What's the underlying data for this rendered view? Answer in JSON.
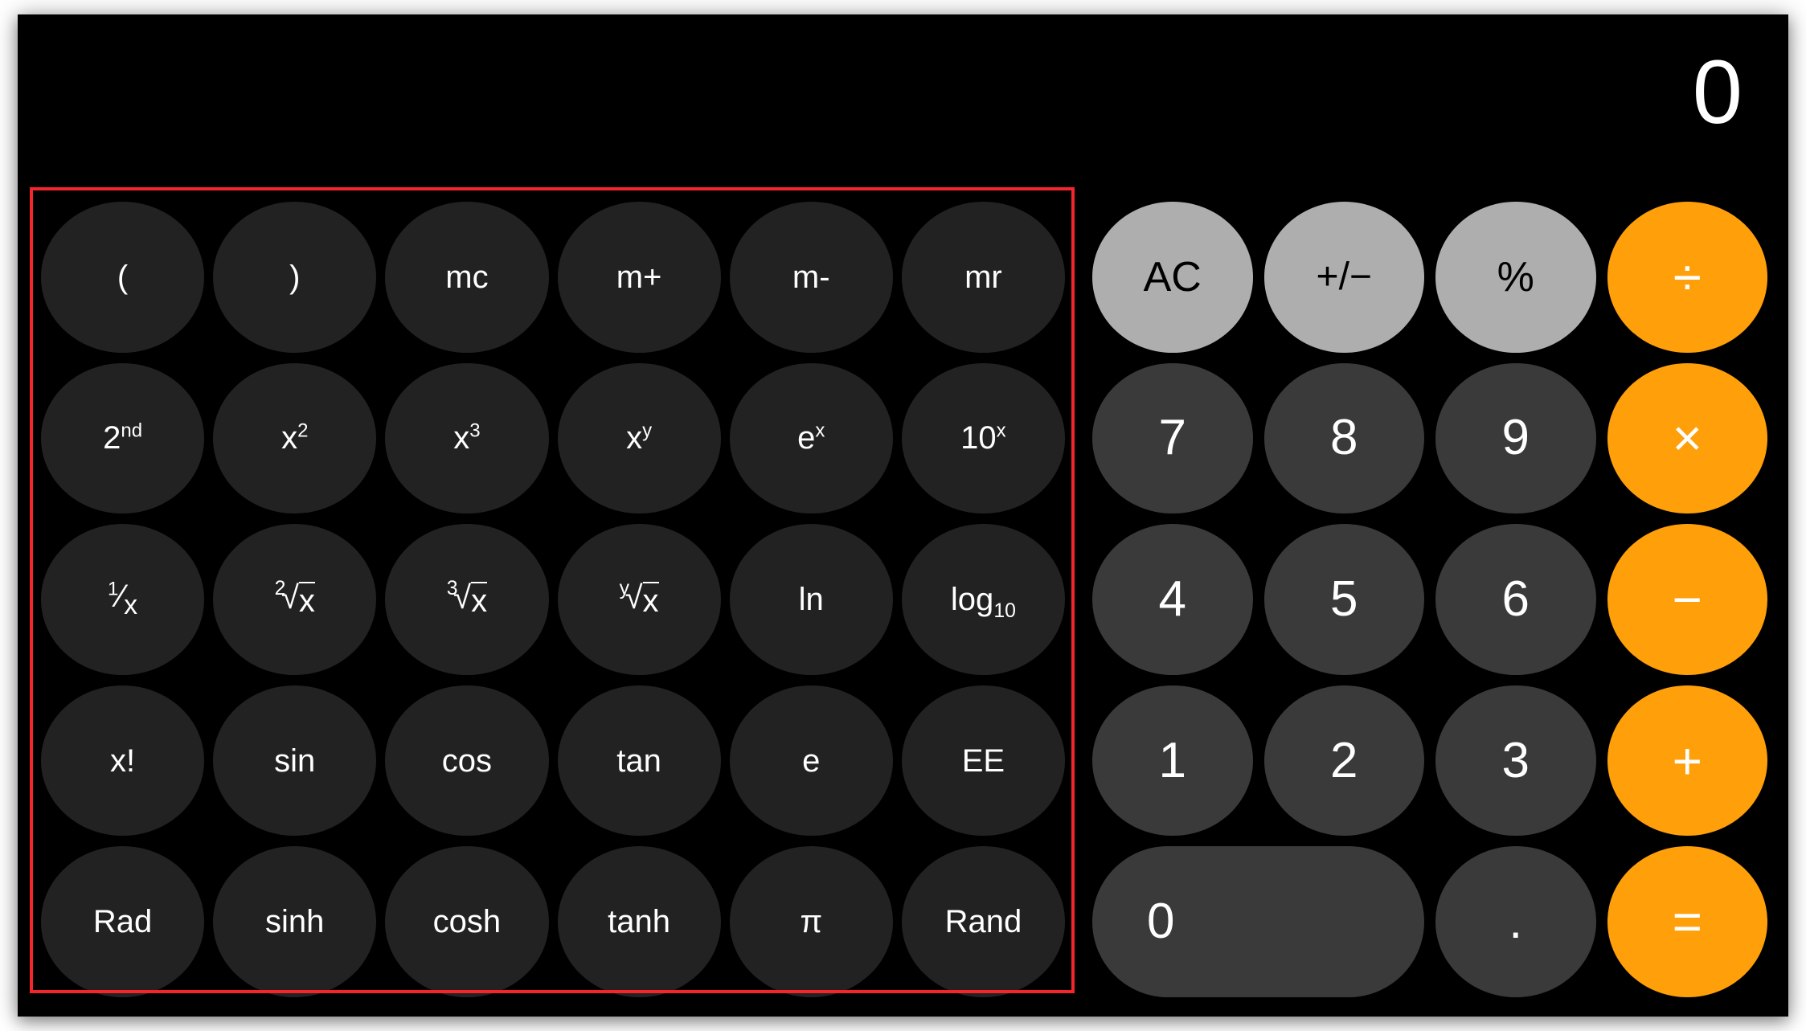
{
  "app": {
    "name": "Calculator",
    "mode": "scientific",
    "theme": "dark"
  },
  "display": {
    "value": "0",
    "alignment": "right"
  },
  "colors": {
    "background": "#000000",
    "scientific_key": "#222222",
    "number_key": "#3a3a3a",
    "function_key": "#aeaeae",
    "operator_key": "#ff9f0a",
    "text_light": "#ffffff",
    "text_dark": "#000000",
    "annotation_box": "#f5252d"
  },
  "annotation": {
    "shape": "rectangle",
    "target": "scientific-keypad",
    "color": "#f5252d"
  },
  "scientific_keypad": {
    "columns": 6,
    "rows": 5,
    "keys": [
      {
        "id": "open-paren",
        "label": "(",
        "name": "key-open-paren"
      },
      {
        "id": "close-paren",
        "label": ")",
        "name": "key-close-paren"
      },
      {
        "id": "mem-clear",
        "label": "mc",
        "name": "key-memory-clear"
      },
      {
        "id": "mem-add",
        "label": "m+",
        "name": "key-memory-add"
      },
      {
        "id": "mem-subtract",
        "label": "m-",
        "name": "key-memory-subtract"
      },
      {
        "id": "mem-recall",
        "label": "mr",
        "name": "key-memory-recall"
      },
      {
        "id": "second",
        "label": "2nd",
        "base": "2",
        "sup": "nd",
        "name": "key-second"
      },
      {
        "id": "x-squared",
        "label": "x2",
        "base": "x",
        "sup": "2",
        "name": "key-x-squared"
      },
      {
        "id": "x-cubed",
        "label": "x3",
        "base": "x",
        "sup": "3",
        "name": "key-x-cubed"
      },
      {
        "id": "x-power-y",
        "label": "xy",
        "base": "x",
        "sup": "y",
        "name": "key-x-power-y"
      },
      {
        "id": "e-power-x",
        "label": "ex",
        "base": "e",
        "sup": "x",
        "name": "key-e-power-x"
      },
      {
        "id": "ten-power-x",
        "label": "10x",
        "base": "10",
        "sup": "x",
        "name": "key-ten-power-x"
      },
      {
        "id": "reciprocal",
        "label": "1/x",
        "name": "key-reciprocal"
      },
      {
        "id": "square-root",
        "label": "2√x",
        "index": "2",
        "radicand": "x",
        "name": "key-square-root"
      },
      {
        "id": "cube-root",
        "label": "3√x",
        "index": "3",
        "radicand": "x",
        "name": "key-cube-root"
      },
      {
        "id": "y-root",
        "label": "y√x",
        "index": "y",
        "radicand": "x",
        "name": "key-y-root"
      },
      {
        "id": "natural-log",
        "label": "ln",
        "name": "key-natural-log"
      },
      {
        "id": "log-base-10",
        "label": "log10",
        "base": "log",
        "sub": "10",
        "name": "key-log-base-10"
      },
      {
        "id": "factorial",
        "label": "x!",
        "name": "key-factorial"
      },
      {
        "id": "sin",
        "label": "sin",
        "name": "key-sin"
      },
      {
        "id": "cos",
        "label": "cos",
        "name": "key-cos"
      },
      {
        "id": "tan",
        "label": "tan",
        "name": "key-tan"
      },
      {
        "id": "euler",
        "label": "e",
        "name": "key-euler"
      },
      {
        "id": "exponent",
        "label": "EE",
        "name": "key-exponent"
      },
      {
        "id": "rad",
        "label": "Rad",
        "name": "key-rad"
      },
      {
        "id": "sinh",
        "label": "sinh",
        "name": "key-sinh"
      },
      {
        "id": "cosh",
        "label": "cosh",
        "name": "key-cosh"
      },
      {
        "id": "tanh",
        "label": "tanh",
        "name": "key-tanh"
      },
      {
        "id": "pi",
        "label": "π",
        "name": "key-pi"
      },
      {
        "id": "rand",
        "label": "Rand",
        "name": "key-rand"
      }
    ]
  },
  "numeric_keypad": {
    "columns": 4,
    "rows": 5,
    "keys": [
      {
        "id": "all-clear",
        "label": "AC",
        "style": "function",
        "name": "key-all-clear"
      },
      {
        "id": "sign",
        "label": "+/−",
        "style": "function",
        "name": "key-toggle-sign"
      },
      {
        "id": "percent",
        "label": "%",
        "style": "function",
        "name": "key-percent"
      },
      {
        "id": "divide",
        "label": "÷",
        "style": "operator",
        "name": "key-divide"
      },
      {
        "id": "seven",
        "label": "7",
        "style": "number",
        "name": "key-7"
      },
      {
        "id": "eight",
        "label": "8",
        "style": "number",
        "name": "key-8"
      },
      {
        "id": "nine",
        "label": "9",
        "style": "number",
        "name": "key-9"
      },
      {
        "id": "multiply",
        "label": "×",
        "style": "operator",
        "name": "key-multiply"
      },
      {
        "id": "four",
        "label": "4",
        "style": "number",
        "name": "key-4"
      },
      {
        "id": "five",
        "label": "5",
        "style": "number",
        "name": "key-5"
      },
      {
        "id": "six",
        "label": "6",
        "style": "number",
        "name": "key-6"
      },
      {
        "id": "subtract",
        "label": "−",
        "style": "operator",
        "name": "key-subtract"
      },
      {
        "id": "one",
        "label": "1",
        "style": "number",
        "name": "key-1"
      },
      {
        "id": "two",
        "label": "2",
        "style": "number",
        "name": "key-2"
      },
      {
        "id": "three",
        "label": "3",
        "style": "number",
        "name": "key-3"
      },
      {
        "id": "add",
        "label": "+",
        "style": "operator",
        "name": "key-add"
      },
      {
        "id": "zero",
        "label": "0",
        "style": "number",
        "wide": true,
        "name": "key-0"
      },
      {
        "id": "decimal",
        "label": ".",
        "style": "number",
        "name": "key-decimal"
      },
      {
        "id": "equals",
        "label": "=",
        "style": "operator",
        "name": "key-equals"
      }
    ]
  }
}
